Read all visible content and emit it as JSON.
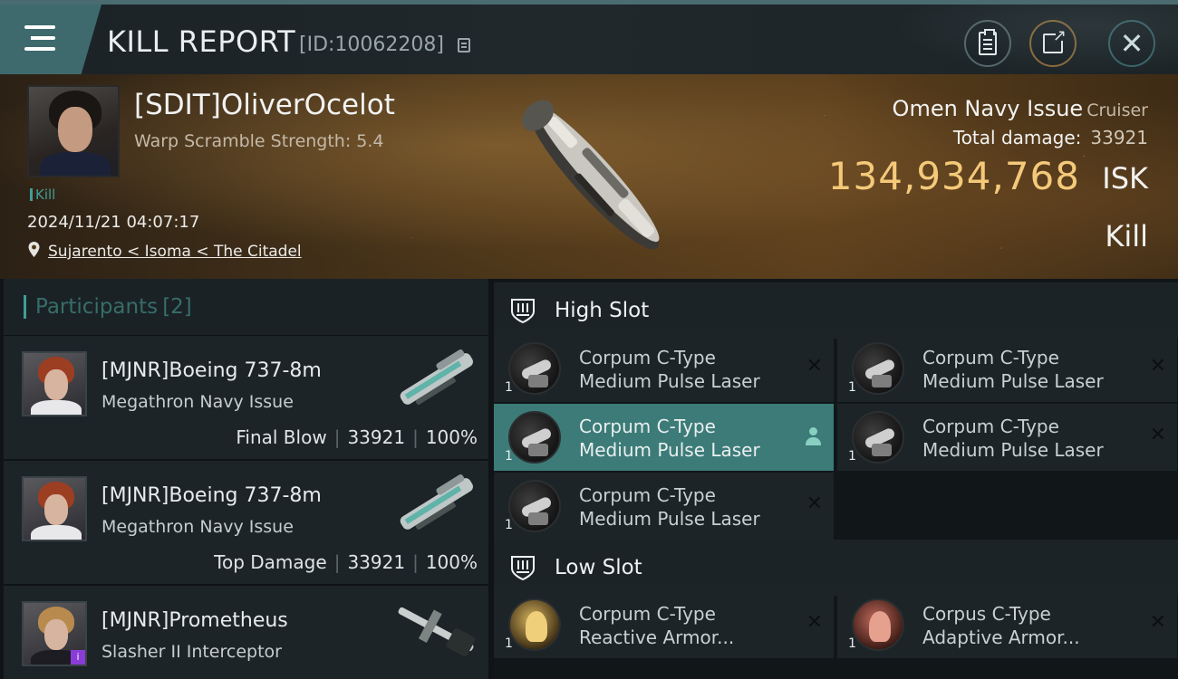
{
  "header": {
    "title": "KILL REPORT",
    "report_id": "[ID:10062208]",
    "icons": {
      "menu": "hamburger-menu-icon",
      "copy": "copy-icon",
      "clipboard": "clipboard-icon",
      "share": "share-icon",
      "close": "close-icon"
    }
  },
  "victim": {
    "pilot": "[SDIT]OliverOcelot",
    "warp_scramble": "Warp Scramble Strength: 5.4",
    "tag": "Kill",
    "datetime": "2024/11/21 04:07:17",
    "location": "Sujarento < Isoma < The Citadel",
    "ship_name": "Omen Navy Issue",
    "ship_class": "Cruiser",
    "total_damage_label": "Total damage:",
    "total_damage_value": "33921",
    "isk_value": "134,934,768",
    "isk_unit": "ISK",
    "outcome": "Kill"
  },
  "participants": {
    "label": "Participants",
    "count": "[2]",
    "rows": [
      {
        "name": "[MJNR]Boeing 737-8m",
        "ship": "Megathron Navy Issue",
        "role": "Final Blow",
        "damage": "33921",
        "percent": "100%"
      },
      {
        "name": "[MJNR]Boeing 737-8m",
        "ship": "Megathron Navy Issue",
        "role": "Top Damage",
        "damage": "33921",
        "percent": "100%"
      },
      {
        "name": "[MJNR]Prometheus",
        "ship": "Slasher II Interceptor",
        "role": "",
        "damage": "",
        "percent": ""
      }
    ]
  },
  "fitting": {
    "high_slot_label": "High Slot",
    "low_slot_label": "Low Slot",
    "high_slot": [
      {
        "line1": "Corpum C-Type",
        "line2": "Medium Pulse Laser",
        "qty": "1",
        "state": "destroyed"
      },
      {
        "line1": "Corpum C-Type",
        "line2": "Medium Pulse Laser",
        "qty": "1",
        "state": "destroyed"
      },
      {
        "line1": "Corpum C-Type",
        "line2": "Medium Pulse Laser",
        "qty": "1",
        "state": "dropped"
      },
      {
        "line1": "Corpum C-Type",
        "line2": "Medium Pulse Laser",
        "qty": "1",
        "state": "destroyed"
      },
      {
        "line1": "Corpum C-Type",
        "line2": "Medium Pulse Laser",
        "qty": "1",
        "state": "destroyed"
      }
    ],
    "low_slot": [
      {
        "line1": "Corpum C-Type",
        "line2": "Reactive Armor...",
        "qty": "1",
        "state": "destroyed"
      },
      {
        "line1": "Corpus C-Type",
        "line2": "Adaptive Armor...",
        "qty": "1",
        "state": "destroyed"
      }
    ],
    "destroyed_mark": "✕"
  },
  "colors": {
    "accent_teal": "#3f9e95",
    "selected_bg": "#3c7b78",
    "isk_gold": "#f5c97a"
  }
}
